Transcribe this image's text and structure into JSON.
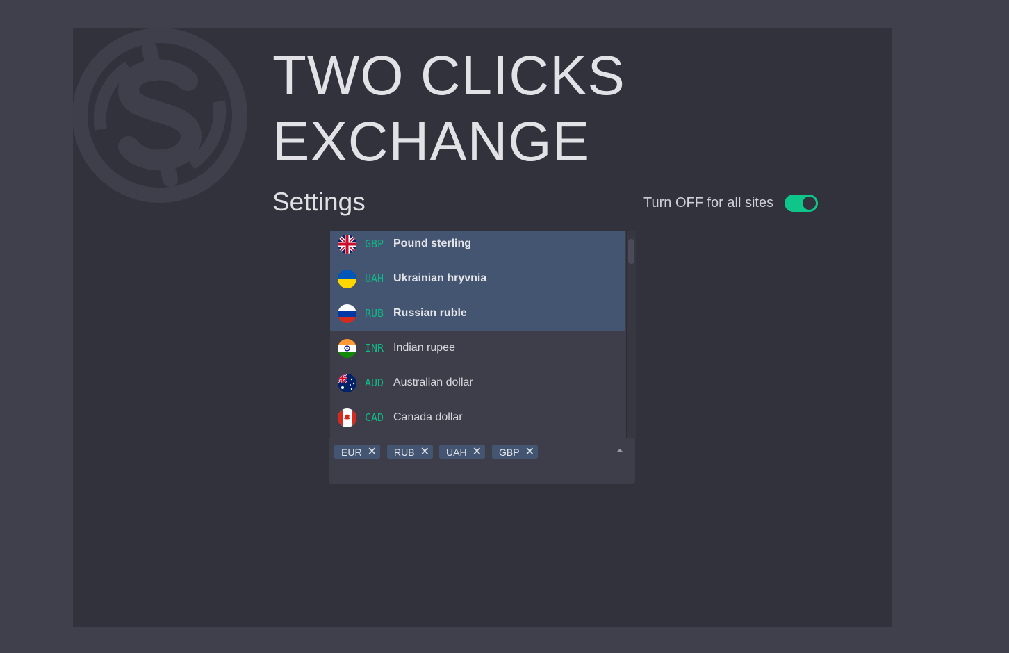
{
  "app": {
    "title_line1": "TWO CLICKS",
    "title_line2": "EXCHANGE",
    "logo_icon": "dollar-exchange-logo-icon"
  },
  "settings": {
    "heading": "Settings",
    "toggle_label": "Turn OFF for all sites",
    "toggle_on": true
  },
  "currency_options": [
    {
      "code": "GBP",
      "name": "Pound sterling",
      "flag": "uk-flag-icon",
      "selected": true
    },
    {
      "code": "UAH",
      "name": "Ukrainian hryvnia",
      "flag": "ukraine-flag-icon",
      "selected": true
    },
    {
      "code": "RUB",
      "name": "Russian ruble",
      "flag": "russia-flag-icon",
      "selected": true
    },
    {
      "code": "INR",
      "name": "Indian rupee",
      "flag": "india-flag-icon",
      "selected": false
    },
    {
      "code": "AUD",
      "name": "Australian dollar",
      "flag": "australia-flag-icon",
      "selected": false
    },
    {
      "code": "CAD",
      "name": "Canada dollar",
      "flag": "canada-flag-icon",
      "selected": false
    }
  ],
  "selected_chips": [
    {
      "label": "EUR",
      "remove": "✕"
    },
    {
      "label": "RUB",
      "remove": "✕"
    },
    {
      "label": "UAH",
      "remove": "✕"
    },
    {
      "label": "GBP",
      "remove": "✕"
    }
  ],
  "search_input": {
    "value": "",
    "placeholder": ""
  },
  "colors": {
    "background": "#40404c",
    "panel": "#32323d",
    "accent": "#0ec68a",
    "selected_row": "#435570"
  }
}
